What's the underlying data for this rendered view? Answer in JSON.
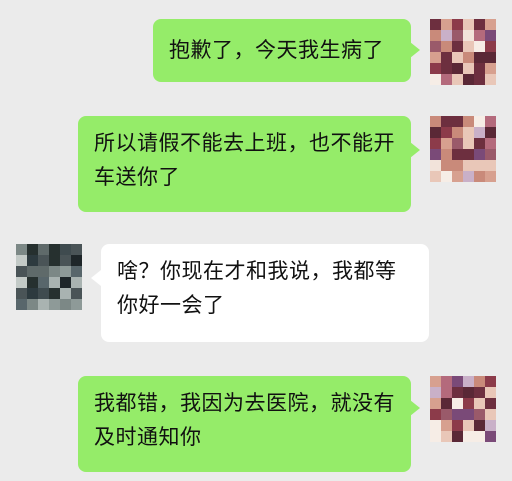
{
  "conversation": {
    "messages": [
      {
        "sender": "me",
        "text": "抱歉了，今天我生病了",
        "avatar": "blurred-avatar-me"
      },
      {
        "sender": "me",
        "text": "所以请假不能去上班，也不能开车送你了",
        "avatar": "blurred-avatar-me"
      },
      {
        "sender": "other",
        "text": "啥？你现在才和我说，我都等你好一会了",
        "avatar": "blurred-avatar-other"
      },
      {
        "sender": "me",
        "text": "我都错，我因为去医院，就没有及时通知你",
        "avatar": "blurred-avatar-me"
      }
    ]
  },
  "colors": {
    "background": "#ebebeb",
    "bubble_me": "#95ec69",
    "bubble_other": "#ffffff",
    "text": "#111111"
  }
}
